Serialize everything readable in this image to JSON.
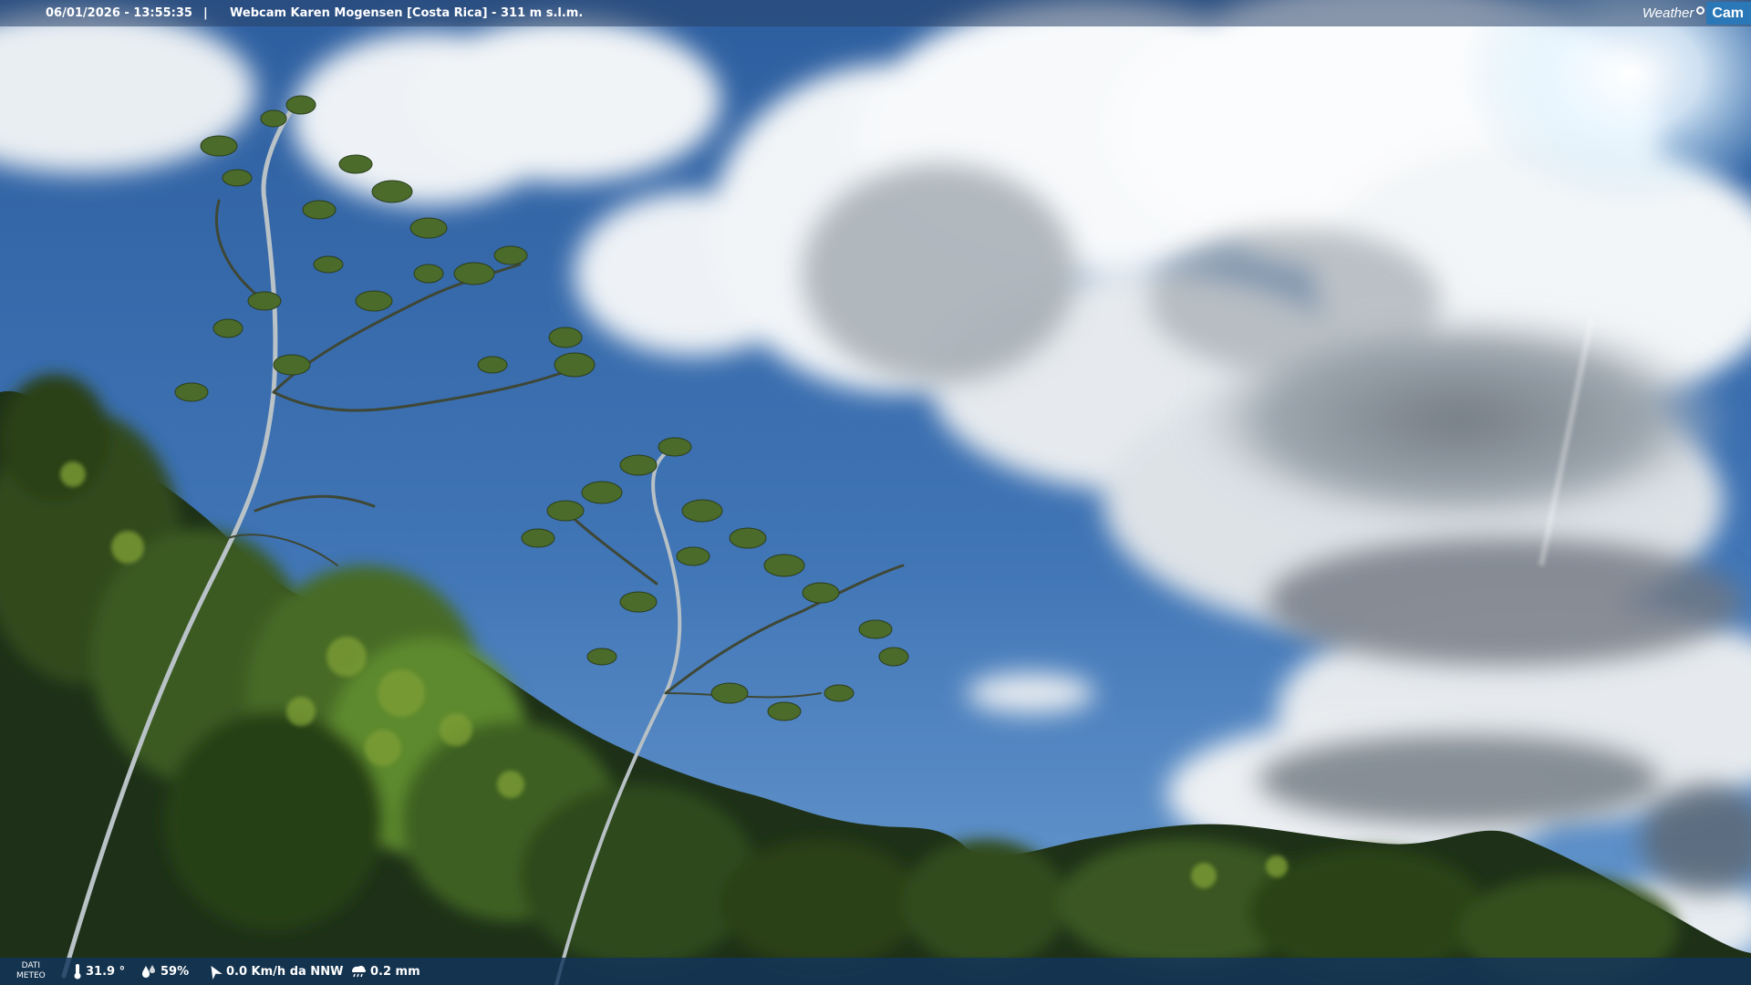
{
  "header": {
    "timestamp": "06/01/2026 - 13:55:35",
    "separator": "|",
    "title": "Webcam Karen Mogensen [Costa Rica] - 311 m s.l.m."
  },
  "logo": {
    "word1": "Weather",
    "word2": "Cam"
  },
  "footer": {
    "dati_line1": "DATI",
    "dati_line2": "METEO",
    "temperature": "31.9 °",
    "humidity": "59%",
    "wind": "0.0 Km/h da NNW",
    "rain": "0.2 mm"
  },
  "colors": {
    "sky_top": "#2f63a8",
    "sky_bottom": "#5b90cc",
    "cloud": "#f4f6f8",
    "cloud_shadow": "#8a949e",
    "foliage_dark": "#1c2e17",
    "foliage_mid": "#3f5e22",
    "foliage_light": "#86a23c",
    "bar_bottom": "#12345c"
  }
}
